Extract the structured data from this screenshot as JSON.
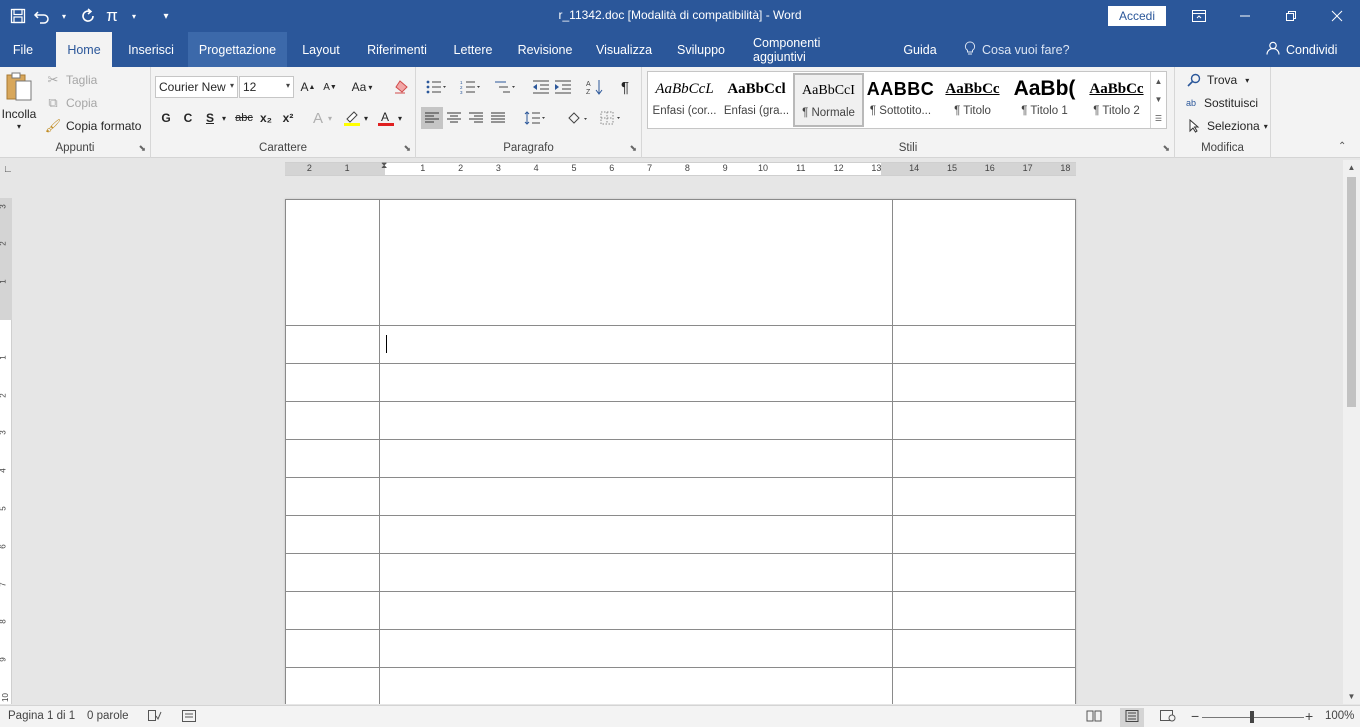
{
  "titlebar": {
    "title": "r_11342.doc [Modalità di compatibilità]  -  Word",
    "sign_in": "Accedi",
    "qat": {
      "save_icon": "save-icon",
      "undo_icon": "undo-icon",
      "redo_icon": "redo-icon",
      "pi": "π",
      "customize": "▾"
    }
  },
  "tabs": [
    {
      "label": "File"
    },
    {
      "label": "Home"
    },
    {
      "label": "Inserisci"
    },
    {
      "label": "Progettazione"
    },
    {
      "label": "Layout"
    },
    {
      "label": "Riferimenti"
    },
    {
      "label": "Lettere"
    },
    {
      "label": "Revisione"
    },
    {
      "label": "Visualizza"
    },
    {
      "label": "Sviluppo"
    },
    {
      "label": "Componenti aggiuntivi"
    },
    {
      "label": "Guida"
    }
  ],
  "tell_me": "Cosa vuoi fare?",
  "share": "Condividi",
  "ribbon": {
    "clipboard": {
      "group_label": "Appunti",
      "paste": "Incolla",
      "cut": "Taglia",
      "copy": "Copia",
      "format_painter": "Copia formato"
    },
    "font": {
      "group_label": "Carattere",
      "font_name": "Courier New",
      "font_size": "12",
      "bold": "G",
      "italic": "C",
      "underline": "S",
      "strike": "abc",
      "subscript": "x₂",
      "superscript": "x²",
      "change_case": "Aa"
    },
    "paragraph": {
      "group_label": "Paragrafo"
    },
    "styles": {
      "group_label": "Stili",
      "items": [
        {
          "preview": "AaBbCcL",
          "label": "Enfasi (cor..."
        },
        {
          "preview": "AaBbCcl",
          "label": "Enfasi (gra..."
        },
        {
          "preview": "AaBbCcI",
          "label": "¶ Normale"
        },
        {
          "preview": "AABBC",
          "label": "¶ Sottotito..."
        },
        {
          "preview": "AaBbCc",
          "label": "¶ Titolo"
        },
        {
          "preview": "AaBb(",
          "label": "¶ Titolo 1"
        },
        {
          "preview": "AaBbCc",
          "label": "¶ Titolo 2"
        }
      ]
    },
    "editing": {
      "group_label": "Modifica",
      "find": "Trova",
      "replace": "Sostituisci",
      "select": "Seleziona"
    }
  },
  "ruler_numbers": [
    "2",
    "1",
    "1",
    "2",
    "3",
    "4",
    "5",
    "6",
    "7",
    "8",
    "9",
    "10",
    "11",
    "12",
    "13",
    "14",
    "15",
    "16",
    "17",
    "18"
  ],
  "vruler_numbers": [
    "3",
    "2",
    "1",
    "1",
    "2",
    "3",
    "4",
    "5",
    "6",
    "7",
    "8",
    "9",
    "10"
  ],
  "statusbar": {
    "page": "Pagina 1 di 1",
    "words": "0 parole",
    "zoom": "100%",
    "zoom_percent": 100
  }
}
